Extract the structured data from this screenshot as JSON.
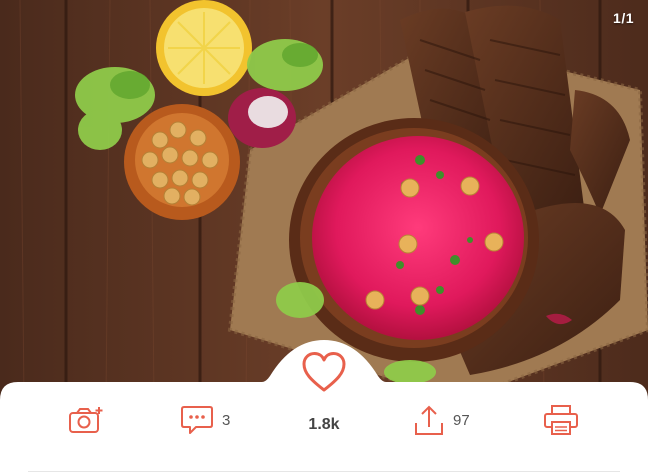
{
  "gallery": {
    "counter": "1/1"
  },
  "actions": {
    "comments_count": "3",
    "likes_count": "1.8k",
    "shares_count": "97"
  },
  "icons": {
    "camera": "camera-plus-icon",
    "comment": "comment-icon",
    "like": "heart-icon",
    "share": "share-icon",
    "print": "printer-icon"
  },
  "colors": {
    "accent": "#e8604c"
  }
}
